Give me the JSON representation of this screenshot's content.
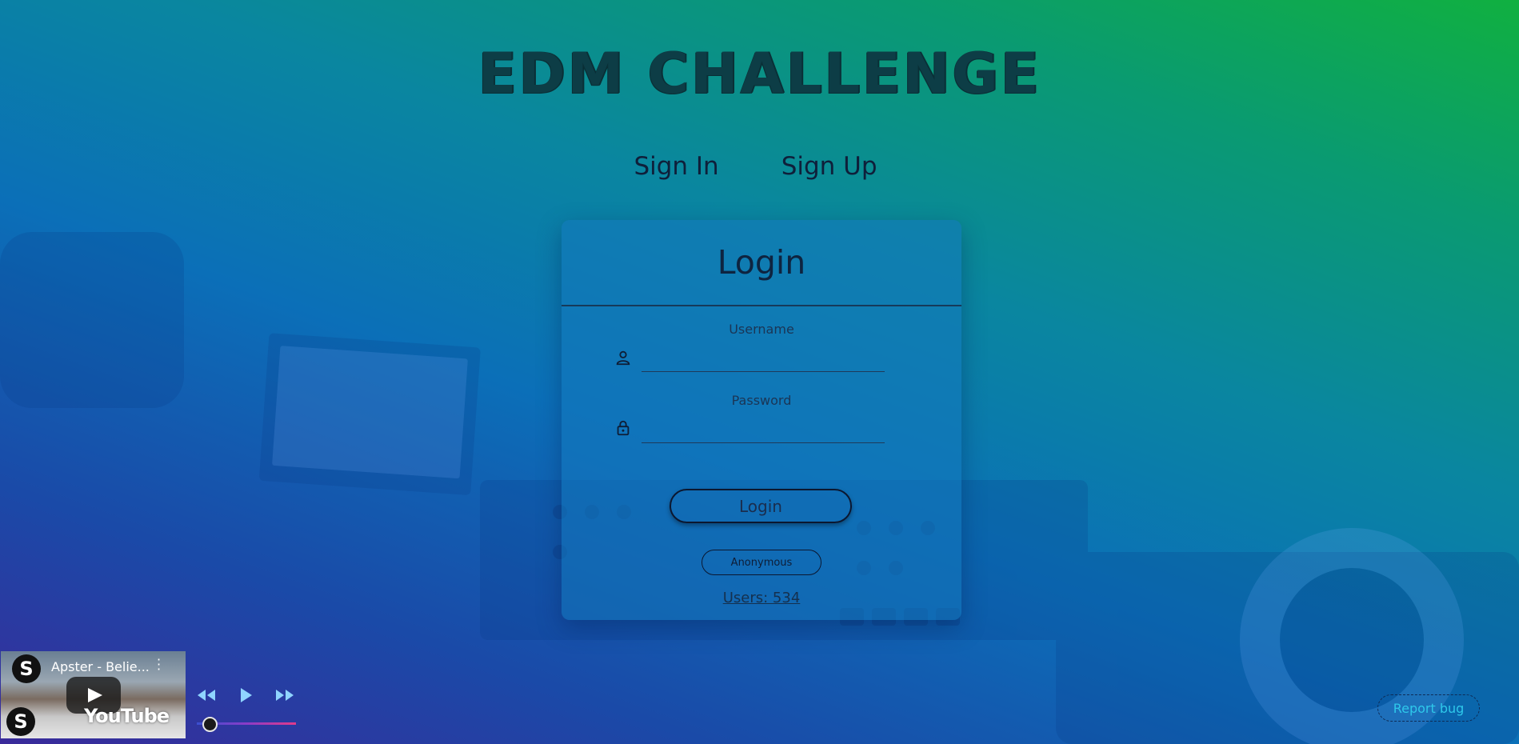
{
  "app": {
    "title": "EDM CHALLENGE"
  },
  "tabs": [
    {
      "label": "Sign In"
    },
    {
      "label": "Sign Up"
    }
  ],
  "login_card": {
    "title": "Login",
    "username": {
      "label": "Username",
      "value": "",
      "placeholder": ""
    },
    "password": {
      "label": "Password",
      "value": "",
      "placeholder": ""
    },
    "login_button": "Login",
    "anonymous_button": "Anonymous",
    "users_count": "Users: 534"
  },
  "player": {
    "video_title": "Apster - Belie...",
    "thumb_brand": "YouTube",
    "progress": 0.1
  },
  "report_bug": "Report bug",
  "icons": {
    "username": "user-icon",
    "password": "lock-icon",
    "rewind": "rewind-icon",
    "play": "play-icon",
    "forward": "fast-forward-icon"
  },
  "colors": {
    "title": "#0d3d46",
    "accent": "#2ec8ea",
    "slider_start": "#3a4fd0",
    "slider_end": "#e23a8a"
  }
}
